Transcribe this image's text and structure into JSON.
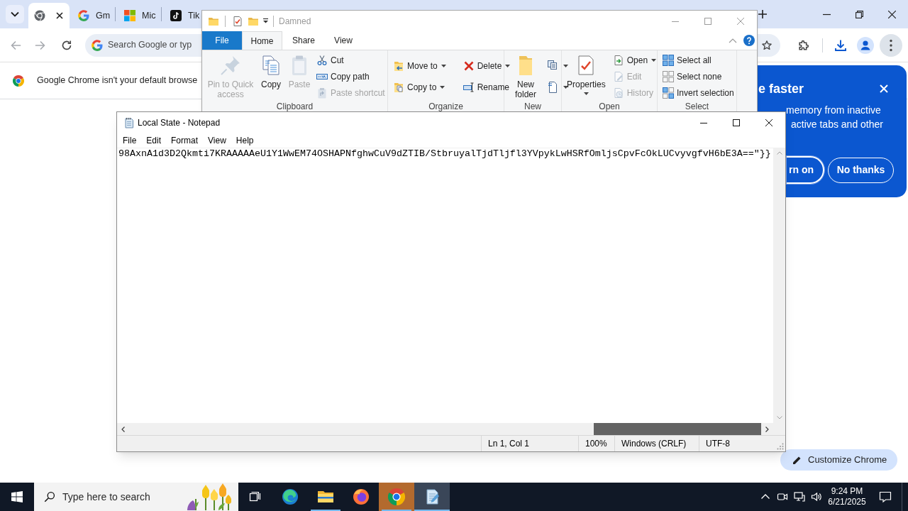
{
  "browser": {
    "tabs": [
      {
        "selected": true
      },
      {
        "title": "Gm",
        "selected": false
      },
      {
        "title": "Mic",
        "selected": false
      },
      {
        "title": "Tik",
        "selected": false
      }
    ],
    "omnibox": {
      "placeholder": "Search Google or typ"
    },
    "infobar": {
      "message": "Google Chrome isn't your default browse"
    },
    "promo": {
      "title": "e faster",
      "body_lines": [
        "memory from inactive",
        "active tabs and other"
      ],
      "buttons": [
        {
          "label": "rn on",
          "kind": "primary"
        },
        {
          "label": "No thanks",
          "kind": "secondary"
        }
      ]
    },
    "customize_button": {
      "label": "Customize Chrome"
    }
  },
  "explorer": {
    "title": "Damned",
    "tabs": [
      {
        "label": "File",
        "kind": "menu",
        "selected": false
      },
      {
        "label": "Home",
        "kind": "tab",
        "selected": true
      },
      {
        "label": "Share",
        "kind": "tab",
        "selected": false
      },
      {
        "label": "View",
        "kind": "tab",
        "selected": false
      }
    ],
    "ribbon": [
      {
        "label": "Clipboard",
        "columns": [
          [
            {
              "label": "Pin to Quick access",
              "kind": "large",
              "disabled": true,
              "dropdown": false
            }
          ],
          [
            {
              "label": "Copy",
              "kind": "large",
              "disabled": false,
              "dropdown": false
            }
          ],
          [
            {
              "label": "Paste",
              "kind": "large",
              "disabled": true,
              "dropdown": false
            }
          ],
          [
            {
              "label": "Cut",
              "kind": "small",
              "disabled": false,
              "dropdown": false
            },
            {
              "label": "Copy path",
              "kind": "small",
              "disabled": false,
              "dropdown": false
            },
            {
              "label": "Paste shortcut",
              "kind": "small",
              "disabled": true,
              "dropdown": false
            }
          ]
        ]
      },
      {
        "label": "Organize",
        "columns": [
          [
            {
              "label": "Move to",
              "kind": "small",
              "disabled": false,
              "dropdown": true
            },
            {
              "label": "Copy to",
              "kind": "small",
              "disabled": false,
              "dropdown": true
            }
          ],
          [
            {
              "label": "Delete",
              "kind": "small",
              "disabled": false,
              "dropdown": true
            },
            {
              "label": "Rename",
              "kind": "small",
              "disabled": false,
              "dropdown": false
            }
          ]
        ]
      },
      {
        "label": "New",
        "columns": [
          [
            {
              "label": "New folder",
              "kind": "large",
              "disabled": false,
              "dropdown": false
            }
          ],
          [
            {
              "kind": "small",
              "disabled": false,
              "dropdown": true
            },
            {
              "kind": "small",
              "disabled": false,
              "dropdown": true
            }
          ]
        ]
      },
      {
        "label": "Open",
        "columns": [
          [
            {
              "label": "Properties",
              "kind": "large",
              "disabled": false,
              "dropdown": true
            }
          ],
          [
            {
              "label": "Open",
              "kind": "small",
              "disabled": false,
              "dropdown": true
            },
            {
              "label": "Edit",
              "kind": "small",
              "disabled": true,
              "dropdown": false
            },
            {
              "label": "History",
              "kind": "small",
              "disabled": true,
              "dropdown": false
            }
          ]
        ]
      },
      {
        "label": "Select",
        "columns": [
          [
            {
              "label": "Select all",
              "kind": "small",
              "disabled": false,
              "dropdown": false
            },
            {
              "label": "Select none",
              "kind": "small",
              "disabled": false,
              "dropdown": false
            },
            {
              "label": "Invert selection",
              "kind": "small",
              "disabled": false,
              "dropdown": false
            }
          ]
        ]
      }
    ]
  },
  "notepad": {
    "title": "Local State - Notepad",
    "menu": [
      "File",
      "Edit",
      "Format",
      "View",
      "Help"
    ],
    "text": "98AxnA1d3D2Qkmti7KRAAAAAeU1Y1WwEM74OSHAPNfghwCuV9dZTIB/StbruyalTjdTljfl3YVpykLwHSRfOmljsCpvFcOkLUCvyvgfvH6bE3A==\"}}",
    "status": [
      "Ln 1, Col 1",
      "100%",
      "Windows (CRLF)",
      "UTF-8"
    ]
  },
  "taskbar": {
    "search": {
      "placeholder": "Type here to search"
    },
    "apps": [
      {
        "running": false,
        "selected": false,
        "flashing": false
      },
      {
        "running": true,
        "selected": false,
        "flashing": false
      },
      {
        "running": false,
        "selected": false,
        "flashing": false
      },
      {
        "running": true,
        "selected": false,
        "flashing": true
      },
      {
        "running": true,
        "selected": true,
        "flashing": false
      }
    ],
    "clock": {
      "time": "9:24 PM",
      "date": "6/21/2025"
    }
  }
}
